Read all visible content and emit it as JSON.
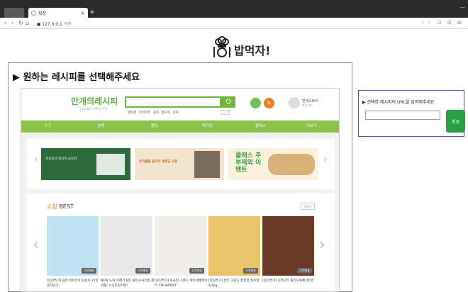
{
  "browser": {
    "tab_title": "확장",
    "tab_close": "×",
    "new_tab": "+",
    "window_control": "—",
    "url_host": "127.0.0.1",
    "url_rest": "백엔",
    "nav_icons": [
      "back-icon",
      "forward-icon",
      "reload-icon",
      "home-icon"
    ]
  },
  "header": {
    "logo_text": "밥먹자!"
  },
  "left_panel": {
    "title": "▶ 원하는 레시피를 선택해주세요"
  },
  "recipe_site": {
    "brand": "만개의레시피",
    "brand_sub": "10000 RECIPE",
    "search_button": "Q",
    "keywords": "밀떡헌 다이어트 김치 밤도독 감자",
    "mini_arrows": "‹ ›",
    "store_label": "만개스토어",
    "store_sub": "바로가기",
    "nav": [
      "추천",
      "분류",
      "랭킹",
      "매거진",
      "클래스",
      "더보기 ⌄"
    ],
    "banners": [
      {
        "text": "건강승식 레시피 공모전"
      },
      {
        "text": "우리출품 걸기미 체험단 모집"
      },
      {
        "text": "클래스 주부제외 이벤트"
      }
    ],
    "best_title_highlight": "쇼핑",
    "best_title_rest": " BEST",
    "more_label": "더보기",
    "products": [
      {
        "name": "[옹진특가] 광천 빅토리아 탄산수 17종 골라담기...",
        "tag": "무료배송",
        "color": "#bfe3f5"
      },
      {
        "name": "NEW 노와 뚝배기 6종 세트(4사은품 계란틀/ 시식후리이벤)",
        "tag": "무료배송",
        "color": "#e9e9e9"
      },
      {
        "name": "[옹진특가] 까사일 스탠드 에어서큘레이터 CM-8800CF",
        "tag": "무료배송",
        "color": "#f1ede8"
      },
      {
        "name": "[옹진특가] 성주 고당도 꿀참외 실속형 4.5kg",
        "tag": "무료배송",
        "color": "#e9c46a"
      },
      {
        "name": "[옹진특가] 오독오독 쫄깃오돌뼈 4인분",
        "tag": "무료배송",
        "color": "#6b3a26"
      }
    ]
  },
  "right_panel": {
    "label": "▶ 선택한 레시피의 URL을 입력해주세요",
    "input_value": "",
    "confirm_button": "확정"
  }
}
